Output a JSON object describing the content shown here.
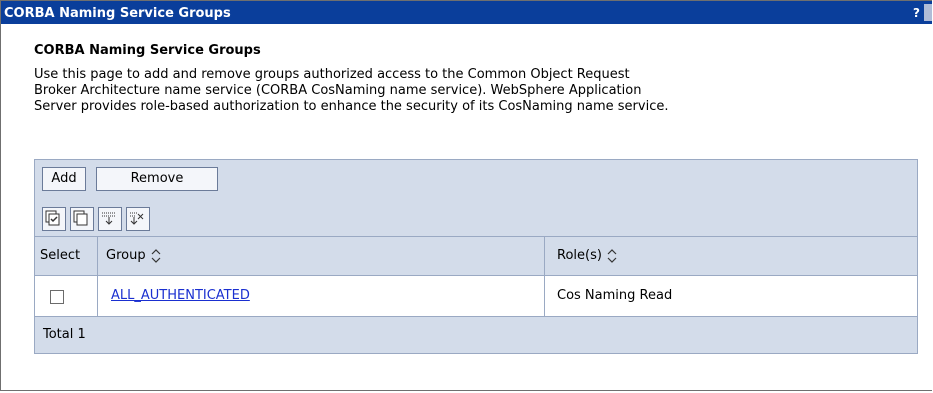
{
  "window": {
    "title": "CORBA Naming Service Groups",
    "help": "?"
  },
  "page": {
    "heading": "CORBA Naming Service Groups",
    "description_lines": [
      "Use this page to add and remove groups authorized access to the Common Object Request",
      "Broker Architecture name service (CORBA CosNaming name service). WebSphere Application",
      "Server provides role-based authorization to enhance the security of its CosNaming name service."
    ]
  },
  "toolbar": {
    "add_label": "Add",
    "remove_label": "Remove",
    "icons": [
      "select-all-icon",
      "deselect-all-icon",
      "show-filter-icon",
      "clear-filter-icon"
    ]
  },
  "table": {
    "columns": [
      "Select",
      "Group",
      "Role(s)"
    ],
    "rows": [
      {
        "group": "ALL_AUTHENTICATED",
        "roles": "Cos Naming Read",
        "selected": false
      }
    ],
    "total_label": "Total 1"
  },
  "colors": {
    "titlebar": "#0a3e9b",
    "panel_bg": "#d3dcea",
    "link": "#1a2fd0"
  }
}
